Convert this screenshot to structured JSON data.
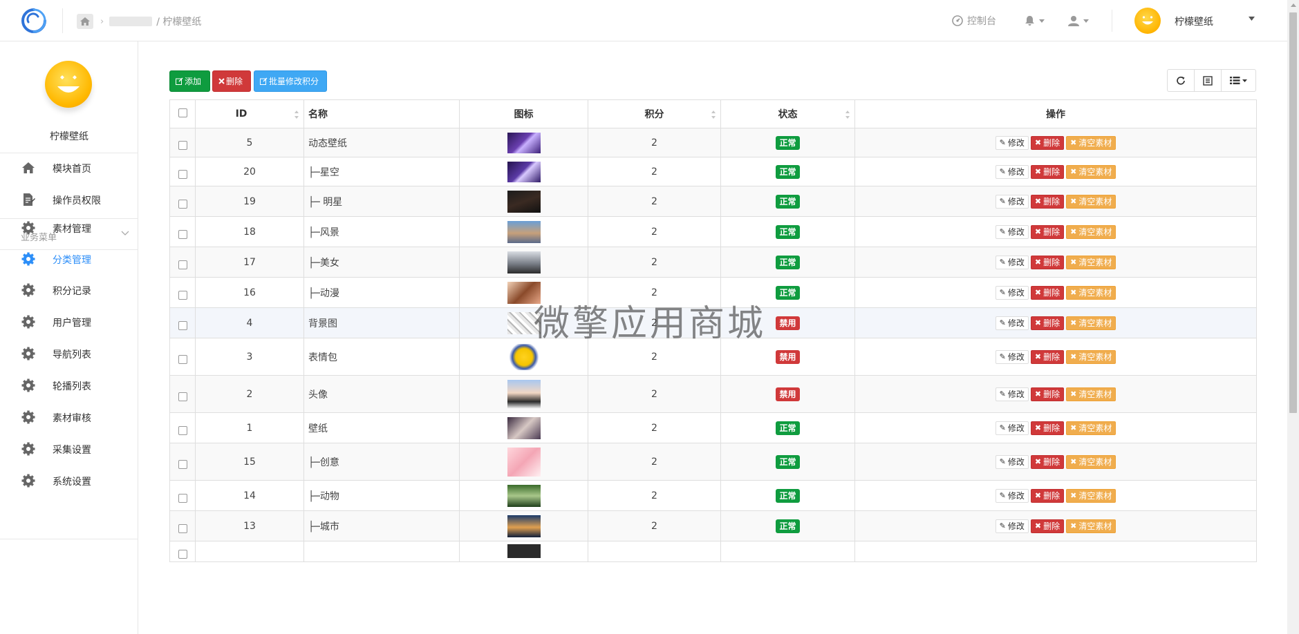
{
  "breadcrumb": {
    "current": "/ 柠檬壁纸"
  },
  "topbar": {
    "console_label": "控制台",
    "user_name": "柠檬壁纸"
  },
  "sidebar": {
    "title": "柠檬壁纸",
    "section_label": "业务菜单",
    "top_items": [
      {
        "label": "模块首页",
        "icon": "home-icon"
      },
      {
        "label": "操作员权限",
        "icon": "document-edit-icon"
      }
    ],
    "items": [
      {
        "label": "素材管理",
        "icon": "gear-icon"
      },
      {
        "label": "分类管理",
        "icon": "gear-icon",
        "active": true
      },
      {
        "label": "积分记录",
        "icon": "gear-icon"
      },
      {
        "label": "用户管理",
        "icon": "gear-icon"
      },
      {
        "label": "导航列表",
        "icon": "gear-icon"
      },
      {
        "label": "轮播列表",
        "icon": "gear-icon"
      },
      {
        "label": "素材审核",
        "icon": "gear-icon"
      },
      {
        "label": "采集设置",
        "icon": "gear-icon"
      },
      {
        "label": "系统设置",
        "icon": "gear-icon"
      }
    ]
  },
  "toolbar": {
    "add_label": "添加",
    "delete_label": "删除",
    "batch_label": "批量修改积分"
  },
  "table": {
    "headers": {
      "id": "ID",
      "name": "名称",
      "icon": "图标",
      "points": "积分",
      "status": "状态",
      "actions": "操作"
    },
    "action_labels": {
      "edit": "修改",
      "delete": "删除",
      "clear": "清空素材"
    },
    "rows": [
      {
        "id": "5",
        "name": "动态壁纸",
        "points": "2",
        "status": "正常"
      },
      {
        "id": "20",
        "name": "├─星空",
        "points": "2",
        "status": "正常"
      },
      {
        "id": "19",
        "name": "├─ 明星",
        "points": "2",
        "status": "正常"
      },
      {
        "id": "18",
        "name": "├─风景",
        "points": "2",
        "status": "正常"
      },
      {
        "id": "17",
        "name": "├─美女",
        "points": "2",
        "status": "正常"
      },
      {
        "id": "16",
        "name": "├─动漫",
        "points": "2",
        "status": "正常"
      },
      {
        "id": "4",
        "name": "背景图",
        "points": "2",
        "status": "禁用"
      },
      {
        "id": "3",
        "name": "表情包",
        "points": "2",
        "status": "禁用"
      },
      {
        "id": "2",
        "name": "头像",
        "points": "2",
        "status": "禁用"
      },
      {
        "id": "1",
        "name": "壁纸",
        "points": "2",
        "status": "正常"
      },
      {
        "id": "15",
        "name": "├─创意",
        "points": "2",
        "status": "正常"
      },
      {
        "id": "14",
        "name": "├─动物",
        "points": "2",
        "status": "正常"
      },
      {
        "id": "13",
        "name": "├─城市",
        "points": "2",
        "status": "正常"
      }
    ]
  },
  "watermark": "微擎应用商城",
  "colors": {
    "accent": "#2c8ef8",
    "success": "#0f9c3f",
    "danger": "#d0393a",
    "warning": "#f0ad4e",
    "info": "#3fa8f4"
  }
}
